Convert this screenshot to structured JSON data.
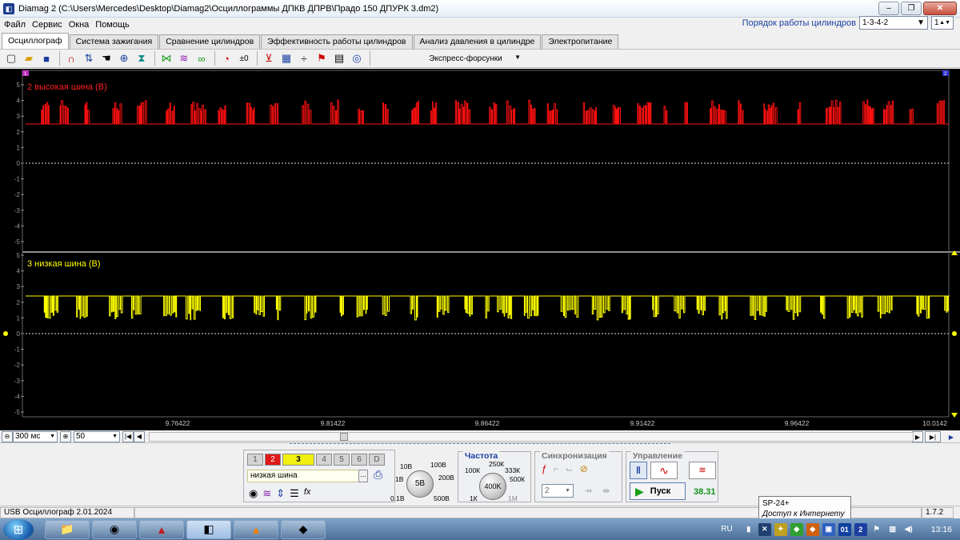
{
  "window": {
    "title": "Diamag 2 (C:\\Users\\Mercedes\\Desktop\\Diamag2\\Осциллограммы ДПКВ ДПРВ\\Прадо 150 ДПУРК 3.dm2)",
    "minimize": "–",
    "maximize": "❐",
    "close": "✕"
  },
  "menu": [
    "Файл",
    "Сервис",
    "Окна",
    "Помощь"
  ],
  "cylinder_order": {
    "label": "Порядок работы цилиндров",
    "value": "1-3-4-2",
    "spin_value": "1"
  },
  "tabs": [
    "Осциллограф",
    "Система зажигания",
    "Сравнение цилиндров",
    "Эффективность работы цилиндров",
    "Анализ давления в цилиндре",
    "Электропитание"
  ],
  "toolbar": {
    "preset": "Экспресс-форсунки"
  },
  "scope": {
    "ch2": {
      "label": "2 высокая шина (В)",
      "color": "#ff1010"
    },
    "ch3": {
      "label": "3 низкая шина (В)",
      "color": "#ffff00"
    },
    "y_ticks": [
      "5",
      "4",
      "3",
      "2",
      "1",
      "0",
      "-1",
      "-2",
      "-3",
      "-4",
      "-5"
    ],
    "x_ticks": [
      "9.76422",
      "9.81422",
      "9.86422",
      "9.91422",
      "9.96422",
      "10.0142"
    ],
    "cursor1": "1",
    "cursor2": "2"
  },
  "timebar": {
    "timebase": "300 мс",
    "zoom": "50"
  },
  "channels": {
    "buttons": [
      "1",
      "2",
      "3",
      "4",
      "5",
      "6",
      "D"
    ],
    "name": "низкая шина",
    "more": "..."
  },
  "volts": {
    "scale_labels": [
      "10В",
      "100В",
      "1В",
      "200В",
      "0.1В",
      "500В"
    ],
    "value": "5В"
  },
  "freq": {
    "title": "Частота",
    "scale_labels": [
      "250К",
      "100К",
      "333К",
      "500К",
      "1К",
      "1М"
    ],
    "value": "400K"
  },
  "sync": {
    "title": "Синхронизация",
    "channel": "2"
  },
  "control": {
    "title": "Управление",
    "start": "Пуск",
    "value": "38.31"
  },
  "status": {
    "left": "USB Осциллограф  2.01.2024",
    "version": "1.7.2"
  },
  "tooltip": {
    "line1": "SP-24+",
    "line2": "Доступ к Интернету"
  },
  "taskbar": {
    "lang": "RU",
    "clock": "13:16"
  }
}
